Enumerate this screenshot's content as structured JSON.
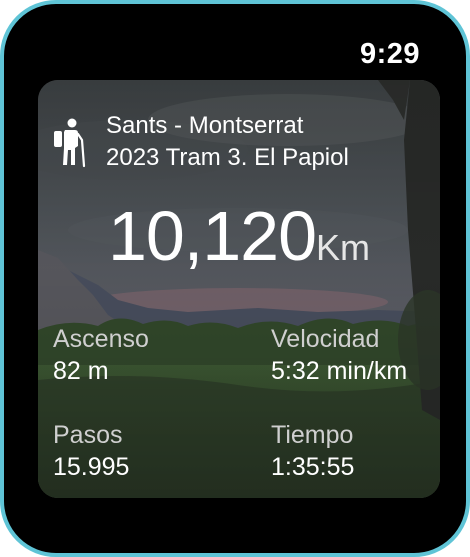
{
  "status_bar": {
    "time": "9:29"
  },
  "activity": {
    "icon": "hiker-icon",
    "route_line1": "Sants - Montserrat",
    "route_line2": "2023 Tram 3. El Papiol",
    "distance_value": "10,120",
    "distance_unit": "Km",
    "stats": [
      {
        "label": "Ascenso",
        "value": "82 m"
      },
      {
        "label": "Velocidad",
        "value": "5:32 min/km"
      },
      {
        "label": "Pasos",
        "value": "15.995"
      },
      {
        "label": "Tiempo",
        "value": "1:35:55"
      }
    ]
  },
  "colors": {
    "bezel": "#5fc4d6",
    "screen": "#000000",
    "text": "#ffffff"
  }
}
